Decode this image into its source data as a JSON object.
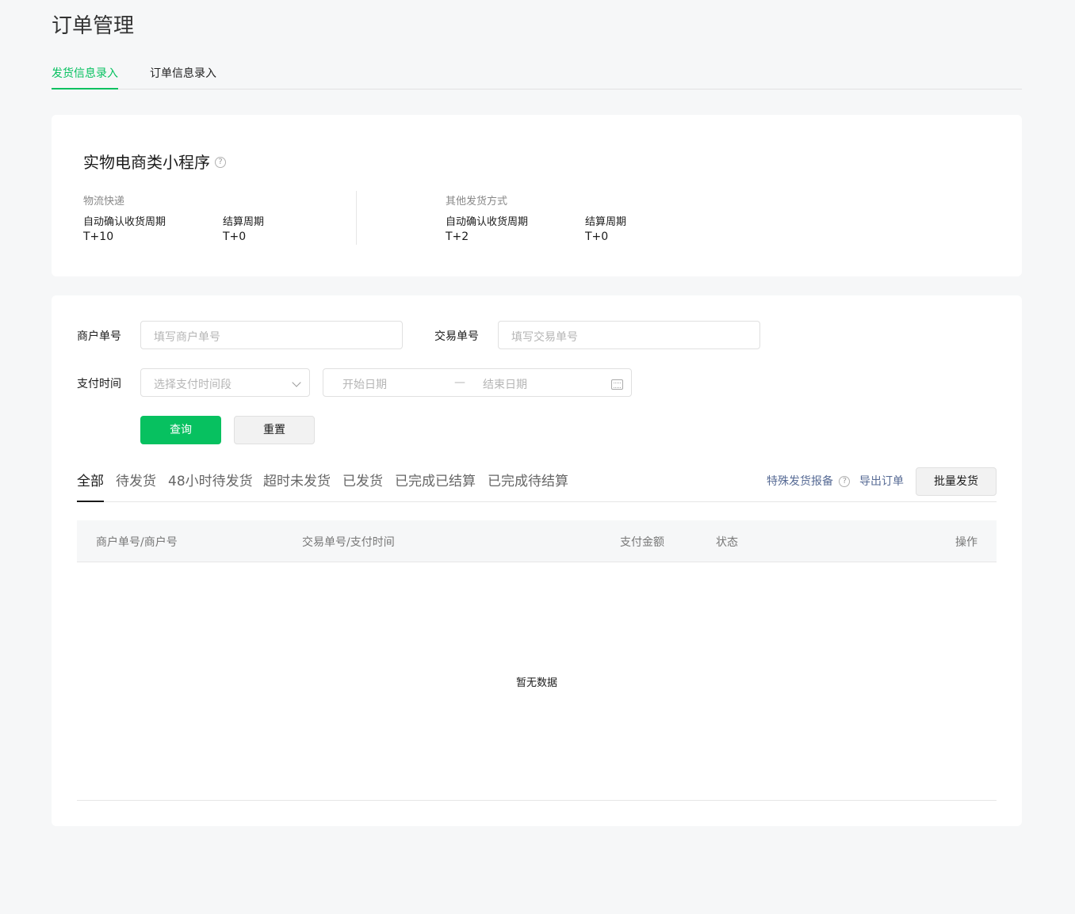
{
  "page": {
    "title": "订单管理"
  },
  "top_tabs": [
    {
      "label": "发货信息录入",
      "active": true
    },
    {
      "label": "订单信息录入",
      "active": false
    }
  ],
  "info_card": {
    "title": "实物电商类小程序",
    "help_icon": "question-circle-icon",
    "groups": [
      {
        "label": "物流快递",
        "fields": [
          {
            "label": "自动确认收货周期",
            "value": "T+10"
          },
          {
            "label": "结算周期",
            "value": "T+0"
          }
        ]
      },
      {
        "label": "其他发货方式",
        "fields": [
          {
            "label": "自动确认收货周期",
            "value": "T+2"
          },
          {
            "label": "结算周期",
            "value": "T+0"
          }
        ]
      }
    ]
  },
  "search_form": {
    "merchant_no": {
      "label": "商户单号",
      "placeholder": "填写商户单号"
    },
    "trade_no": {
      "label": "交易单号",
      "placeholder": "填写交易单号"
    },
    "pay_time": {
      "label": "支付时间",
      "select_placeholder": "选择支付时间段",
      "start_placeholder": "开始日期",
      "separator": "—",
      "end_placeholder": "结束日期"
    },
    "query_button": "查询",
    "reset_button": "重置"
  },
  "status_tabs": [
    {
      "label": "全部",
      "active": true
    },
    {
      "label": "待发货",
      "active": false
    },
    {
      "label": "48小时待发货",
      "active": false
    },
    {
      "label": "超时未发货",
      "active": false
    },
    {
      "label": "已发货",
      "active": false
    },
    {
      "label": "已完成已结算",
      "active": false
    },
    {
      "label": "已完成待结算",
      "active": false
    }
  ],
  "actions": {
    "special_report": "特殊发货报备",
    "export": "导出订单",
    "batch_ship": "批量发货"
  },
  "table": {
    "columns": [
      "商户单号/商户号",
      "交易单号/支付时间",
      "支付金额",
      "状态",
      "操作"
    ],
    "empty_text": "暂无数据"
  },
  "colors": {
    "accent": "#07c160",
    "link": "#576b95"
  }
}
